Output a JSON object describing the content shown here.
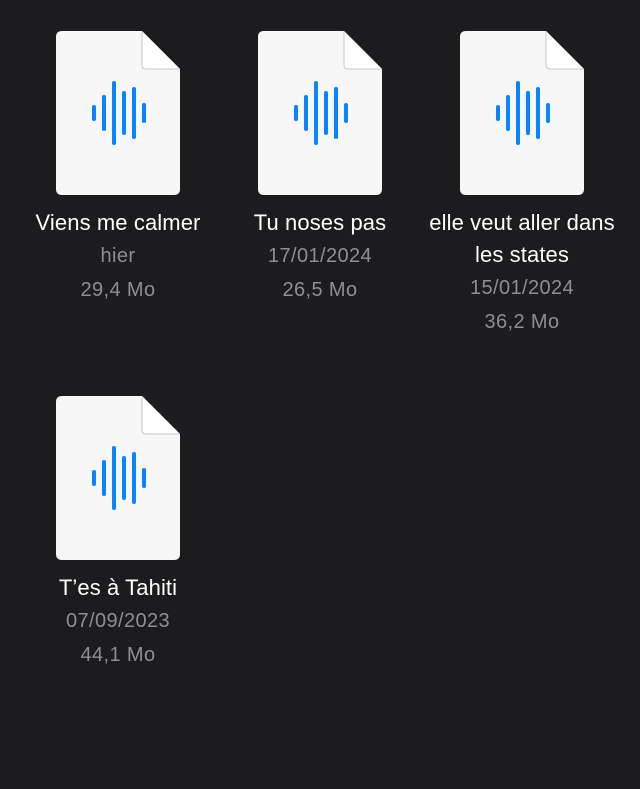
{
  "accent_color": "#0a84ff",
  "file_icon": "audio-waveform-icon",
  "files": [
    {
      "name": "Viens me calmer",
      "date": "hier",
      "size": "29,4 Mo"
    },
    {
      "name": "Tu noses pas",
      "date": "17/01/2024",
      "size": "26,5 Mo"
    },
    {
      "name": "elle veut aller dans les states",
      "date": "15/01/2024",
      "size": "36,2 Mo"
    },
    {
      "name": "T’es à Tahiti",
      "date": "07/09/2023",
      "size": "44,1 Mo"
    }
  ]
}
